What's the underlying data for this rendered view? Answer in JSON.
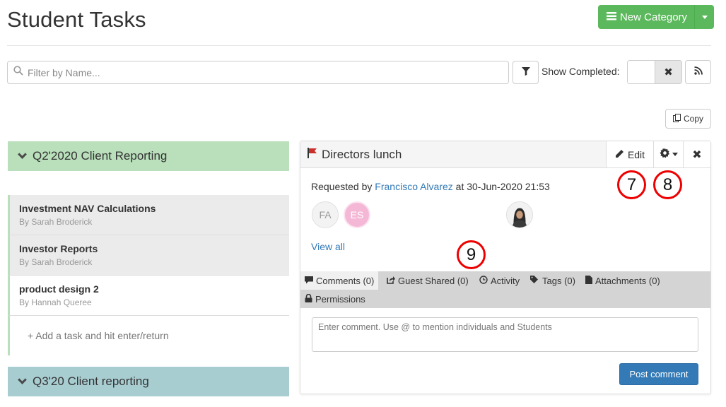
{
  "page": {
    "title": "Student Tasks"
  },
  "toolbar": {
    "new_category_label": "New Category",
    "filter_placeholder": "Filter by Name...",
    "show_completed_label": "Show Completed:",
    "copy_label": "Copy"
  },
  "categories": [
    {
      "name": "Q2'2020 Client Reporting",
      "tasks": [
        {
          "title": "Investment NAV Calculations",
          "by": "By Sarah Broderick"
        },
        {
          "title": "Investor Reports",
          "by": "By Sarah Broderick"
        },
        {
          "title": "product design 2",
          "by": "By Hannah Queree"
        }
      ],
      "add_task_label": "+ Add a task and hit enter/return"
    },
    {
      "name": "Q3'20 Client reporting"
    }
  ],
  "detail": {
    "title": "Directors lunch",
    "edit_label": "Edit",
    "requested_prefix": "Requested by",
    "requester": "Francisco Alvarez",
    "requested_suffix": "at 30-Jun-2020 21:53",
    "avatars": [
      "FA",
      "ES"
    ],
    "view_all_label": "View all",
    "tabs": [
      "Comments (0)",
      "Guest Shared (0)",
      "Activity",
      "Tags (0)",
      "Attachments (0)",
      "Permissions"
    ],
    "comment_placeholder": "Enter comment. Use @ to mention individuals and Students",
    "post_label": "Post comment"
  },
  "callouts": [
    "7",
    "8",
    "9"
  ],
  "colors": {
    "success": "#5cb85c",
    "primary": "#337ab7",
    "category_green": "#b9dfbb",
    "category_teal": "#a8cdd1",
    "flag": "#c9302c",
    "callout": "#e00000"
  }
}
